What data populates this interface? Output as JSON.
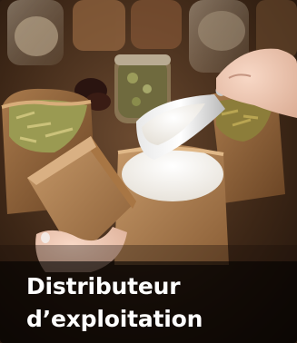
{
  "card": {
    "title_line1": "Distributeur",
    "title_line2": "d’exploitation"
  },
  "image": {
    "subject": "bulk-food-photo"
  },
  "colors": {
    "overlay": "#000000",
    "text": "#ffffff"
  }
}
